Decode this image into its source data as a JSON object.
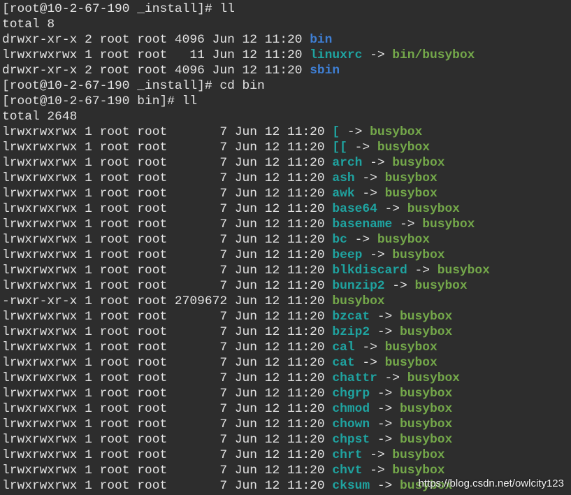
{
  "terminal": {
    "lines": [
      {
        "type": "text",
        "text": "[root@10-2-67-190 _install]# ll"
      },
      {
        "type": "text",
        "text": "total 8"
      },
      {
        "type": "entry",
        "meta": "drwxr-xr-x 2 root root 4096 Jun 12 11:20 ",
        "name": "bin",
        "kind": "dir"
      },
      {
        "type": "entry",
        "meta": "lrwxrwxrwx 1 root root   11 Jun 12 11:20 ",
        "name": "linuxrc",
        "kind": "link",
        "target": "bin/busybox"
      },
      {
        "type": "entry",
        "meta": "drwxr-xr-x 2 root root 4096 Jun 12 11:20 ",
        "name": "sbin",
        "kind": "dir"
      },
      {
        "type": "text",
        "text": "[root@10-2-67-190 _install]# cd bin"
      },
      {
        "type": "text",
        "text": "[root@10-2-67-190 bin]# ll"
      },
      {
        "type": "text",
        "text": "total 2648"
      },
      {
        "type": "entry",
        "meta": "lrwxrwxrwx 1 root root       7 Jun 12 11:20 ",
        "name": "[",
        "kind": "link",
        "target": "busybox"
      },
      {
        "type": "entry",
        "meta": "lrwxrwxrwx 1 root root       7 Jun 12 11:20 ",
        "name": "[[",
        "kind": "link",
        "target": "busybox"
      },
      {
        "type": "entry",
        "meta": "lrwxrwxrwx 1 root root       7 Jun 12 11:20 ",
        "name": "arch",
        "kind": "link",
        "target": "busybox"
      },
      {
        "type": "entry",
        "meta": "lrwxrwxrwx 1 root root       7 Jun 12 11:20 ",
        "name": "ash",
        "kind": "link",
        "target": "busybox"
      },
      {
        "type": "entry",
        "meta": "lrwxrwxrwx 1 root root       7 Jun 12 11:20 ",
        "name": "awk",
        "kind": "link",
        "target": "busybox"
      },
      {
        "type": "entry",
        "meta": "lrwxrwxrwx 1 root root       7 Jun 12 11:20 ",
        "name": "base64",
        "kind": "link",
        "target": "busybox"
      },
      {
        "type": "entry",
        "meta": "lrwxrwxrwx 1 root root       7 Jun 12 11:20 ",
        "name": "basename",
        "kind": "link",
        "target": "busybox"
      },
      {
        "type": "entry",
        "meta": "lrwxrwxrwx 1 root root       7 Jun 12 11:20 ",
        "name": "bc",
        "kind": "link",
        "target": "busybox"
      },
      {
        "type": "entry",
        "meta": "lrwxrwxrwx 1 root root       7 Jun 12 11:20 ",
        "name": "beep",
        "kind": "link",
        "target": "busybox"
      },
      {
        "type": "entry",
        "meta": "lrwxrwxrwx 1 root root       7 Jun 12 11:20 ",
        "name": "blkdiscard",
        "kind": "link",
        "target": "busybox"
      },
      {
        "type": "entry",
        "meta": "lrwxrwxrwx 1 root root       7 Jun 12 11:20 ",
        "name": "bunzip2",
        "kind": "link",
        "target": "busybox"
      },
      {
        "type": "entry",
        "meta": "-rwxr-xr-x 1 root root 2709672 Jun 12 11:20 ",
        "name": "busybox",
        "kind": "exec"
      },
      {
        "type": "entry",
        "meta": "lrwxrwxrwx 1 root root       7 Jun 12 11:20 ",
        "name": "bzcat",
        "kind": "link",
        "target": "busybox"
      },
      {
        "type": "entry",
        "meta": "lrwxrwxrwx 1 root root       7 Jun 12 11:20 ",
        "name": "bzip2",
        "kind": "link",
        "target": "busybox"
      },
      {
        "type": "entry",
        "meta": "lrwxrwxrwx 1 root root       7 Jun 12 11:20 ",
        "name": "cal",
        "kind": "link",
        "target": "busybox"
      },
      {
        "type": "entry",
        "meta": "lrwxrwxrwx 1 root root       7 Jun 12 11:20 ",
        "name": "cat",
        "kind": "link",
        "target": "busybox"
      },
      {
        "type": "entry",
        "meta": "lrwxrwxrwx 1 root root       7 Jun 12 11:20 ",
        "name": "chattr",
        "kind": "link",
        "target": "busybox"
      },
      {
        "type": "entry",
        "meta": "lrwxrwxrwx 1 root root       7 Jun 12 11:20 ",
        "name": "chgrp",
        "kind": "link",
        "target": "busybox"
      },
      {
        "type": "entry",
        "meta": "lrwxrwxrwx 1 root root       7 Jun 12 11:20 ",
        "name": "chmod",
        "kind": "link",
        "target": "busybox"
      },
      {
        "type": "entry",
        "meta": "lrwxrwxrwx 1 root root       7 Jun 12 11:20 ",
        "name": "chown",
        "kind": "link",
        "target": "busybox"
      },
      {
        "type": "entry",
        "meta": "lrwxrwxrwx 1 root root       7 Jun 12 11:20 ",
        "name": "chpst",
        "kind": "link",
        "target": "busybox"
      },
      {
        "type": "entry",
        "meta": "lrwxrwxrwx 1 root root       7 Jun 12 11:20 ",
        "name": "chrt",
        "kind": "link",
        "target": "busybox"
      },
      {
        "type": "entry",
        "meta": "lrwxrwxrwx 1 root root       7 Jun 12 11:20 ",
        "name": "chvt",
        "kind": "link",
        "target": "busybox"
      },
      {
        "type": "entry",
        "meta": "lrwxrwxrwx 1 root root       7 Jun 12 11:20 ",
        "name": "cksum",
        "kind": "link",
        "target": "busybox"
      }
    ],
    "arrow": " -> ",
    "watermark": "https://blog.csdn.net/owlcity123"
  },
  "colors": {
    "background": "#2d2d2d",
    "text": "#e3e3e3",
    "directory": "#3f7fd4",
    "symlink": "#1fa3a0",
    "executable": "#74a84a"
  }
}
